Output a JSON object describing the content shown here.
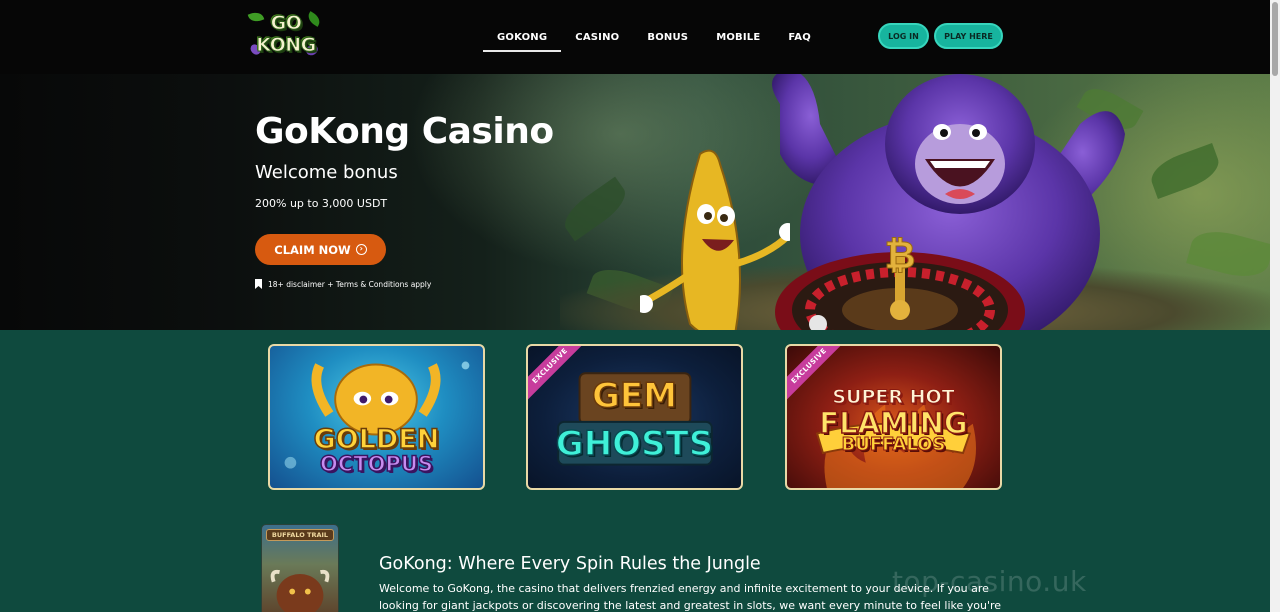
{
  "header": {
    "logo_text": "GO KONG",
    "nav": [
      {
        "label": "GOKONG",
        "active": true
      },
      {
        "label": "CASINO",
        "active": false
      },
      {
        "label": "BONUS",
        "active": false
      },
      {
        "label": "MOBILE",
        "active": false
      },
      {
        "label": "FAQ",
        "active": false
      }
    ],
    "login_label": "LOG IN",
    "play_label": "PLAY HERE"
  },
  "hero": {
    "title": "GoKong Casino",
    "subtitle": "Welcome bonus",
    "offer": "200% up to 3,000 USDT",
    "cta_label": "CLAIM NOW",
    "cta_icon": "arrow-circle-icon",
    "disclaimer": "18+ disclaimer + Terms & Conditions apply"
  },
  "games": [
    {
      "title_line1": "GOLDEN",
      "title_line2": "OCTOPUS",
      "exclusive": false
    },
    {
      "title_line1": "GEM",
      "title_line2": "GHOSTS",
      "exclusive": true,
      "badge": "EXCLUSIVE"
    },
    {
      "title_line1": "SUPER HOT",
      "title_line2": "FLAMING",
      "title_line3": "BUFFALOS",
      "exclusive": true,
      "badge": "EXCLUSIVE"
    }
  ],
  "article": {
    "thumb_label": "BUFFALO TRAIL",
    "title": "GoKong: Where Every Spin Rules the Jungle",
    "body": "Welcome to GoKong, the casino that delivers frenzied energy and infinite excitement to your device. If you are looking for giant jackpots or discovering the latest and greatest in slots, we want every minute to feel like you're winning. With safe"
  },
  "watermark": "top-casino.uk",
  "colors": {
    "accent_teal": "#17b49e",
    "cta_orange": "#d75a10",
    "page_green": "#0f4a3e",
    "header_black": "#060606"
  }
}
